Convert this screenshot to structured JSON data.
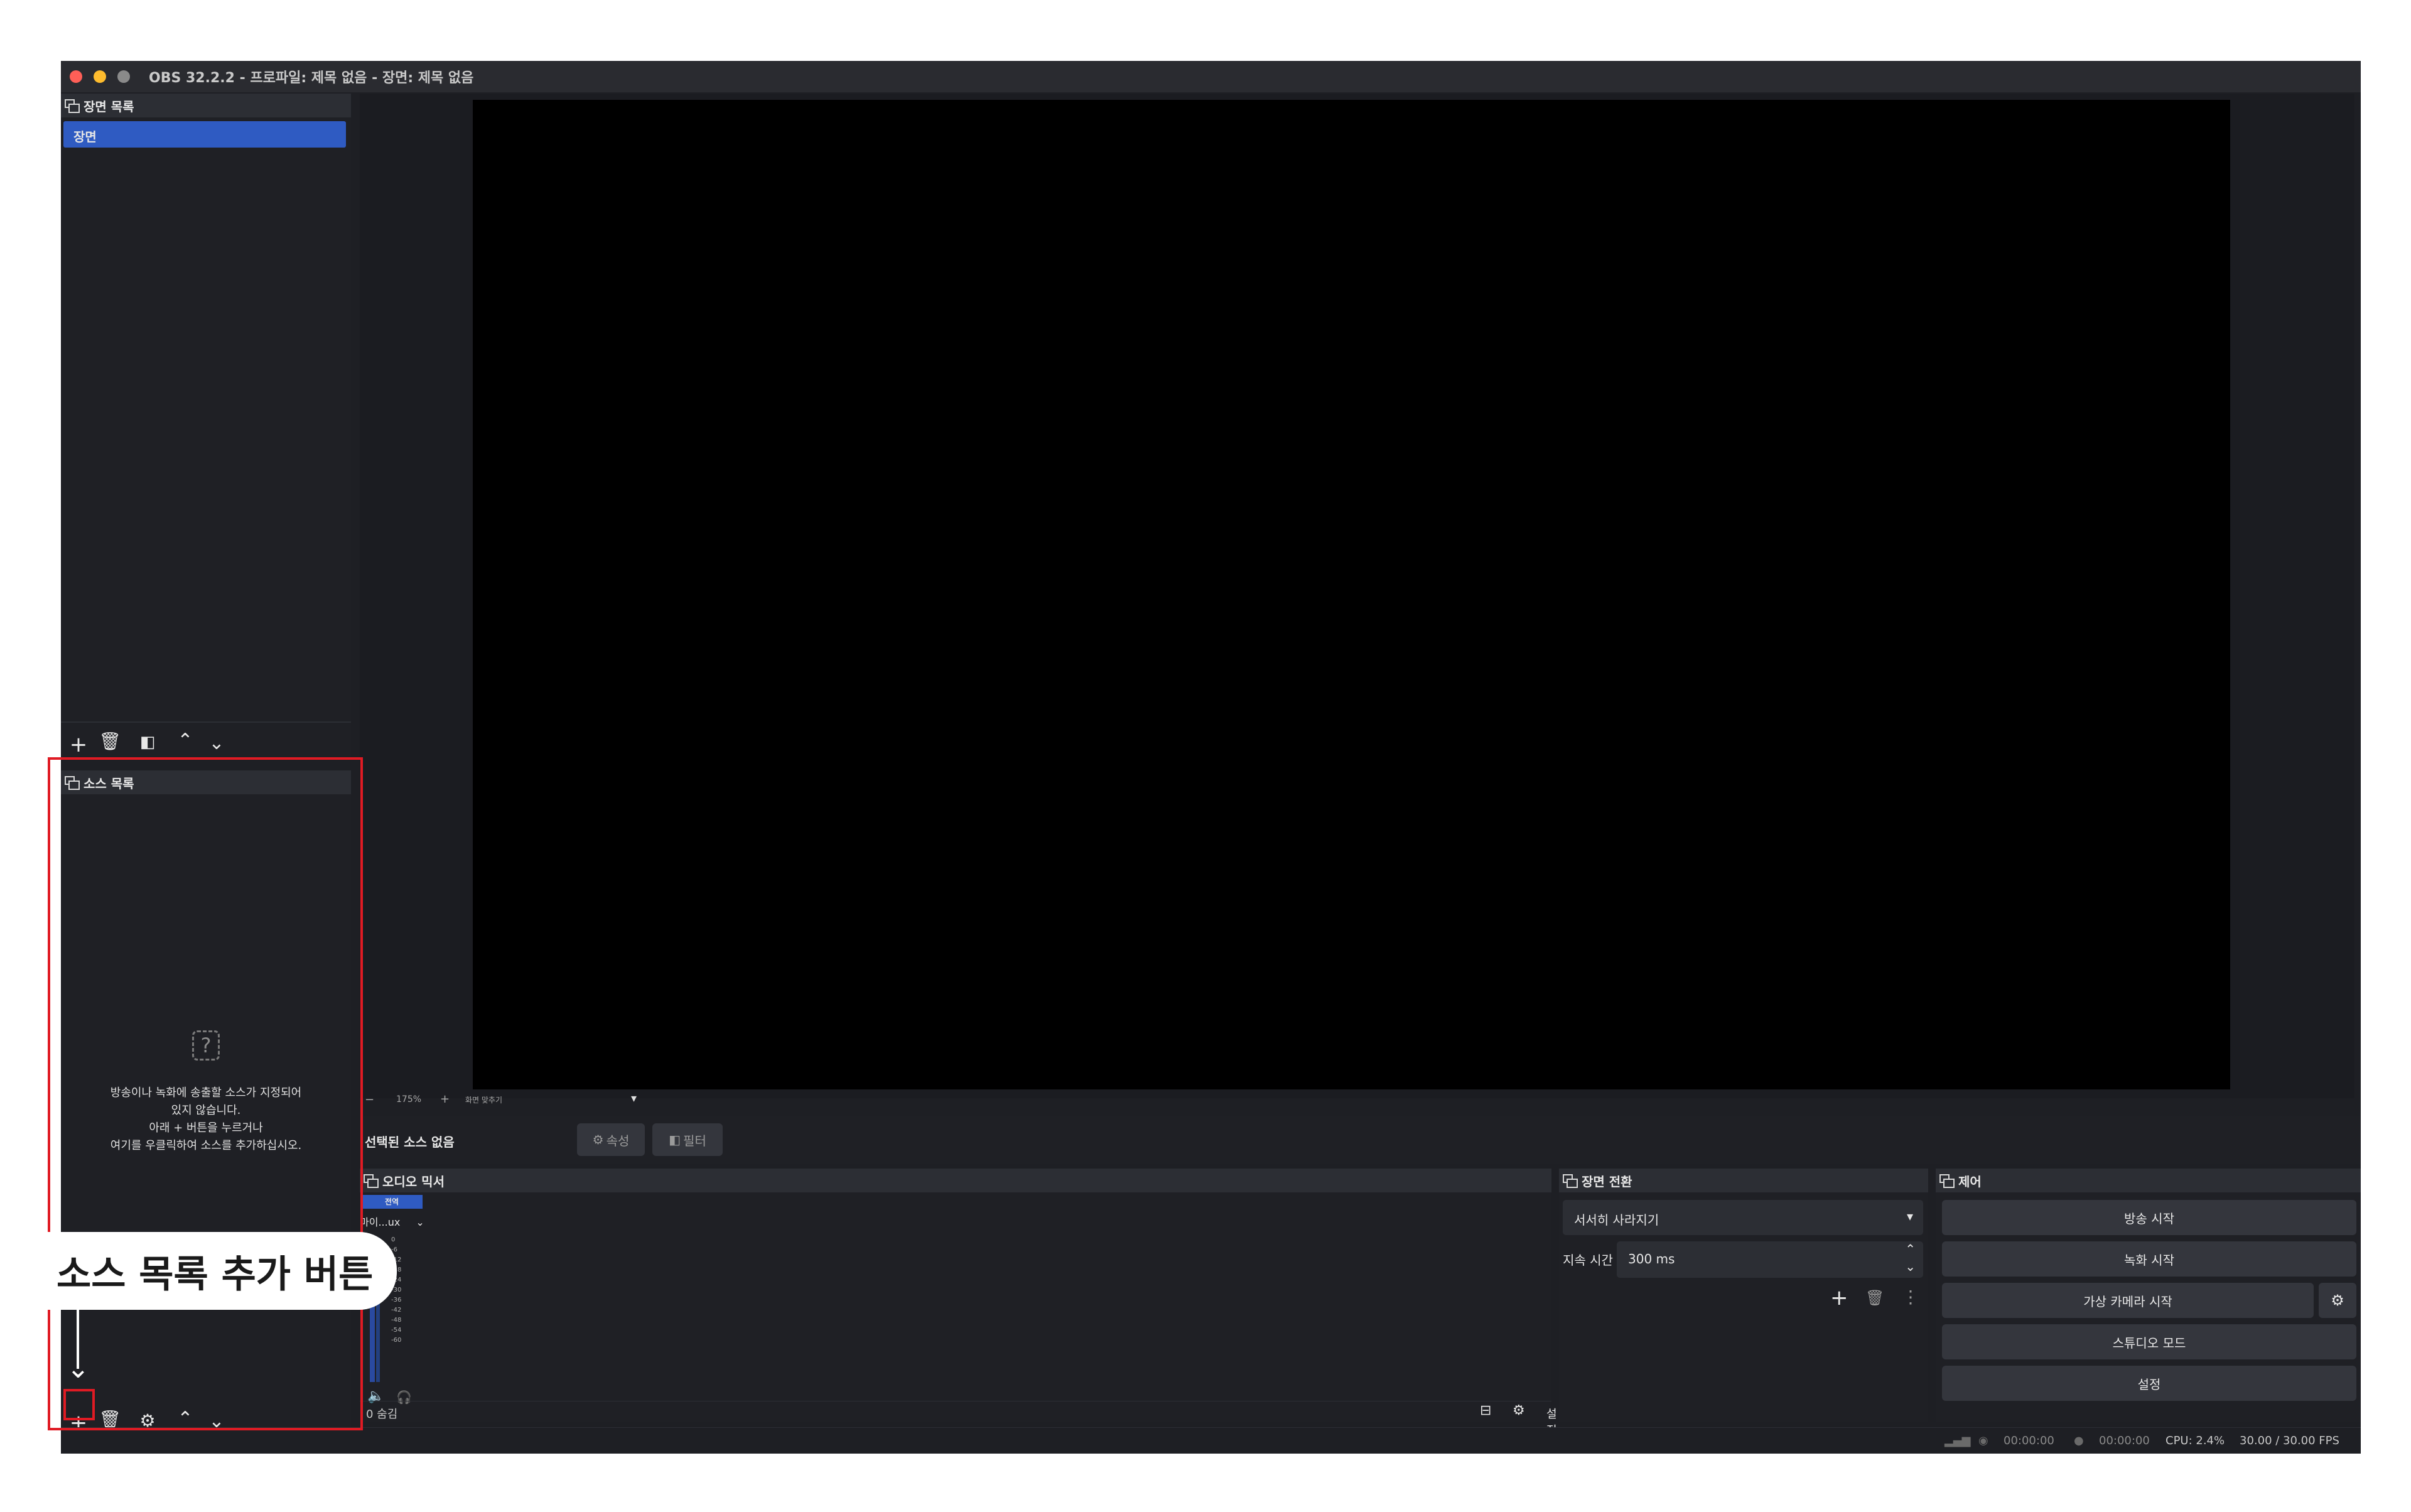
{
  "window": {
    "title": "OBS 32.2.2 - 프로파일: 제목 없음 - 장면: 제목 없음"
  },
  "scenes": {
    "header": "장면 목록",
    "items": [
      "장면"
    ]
  },
  "sources": {
    "header": "소스 목록",
    "empty_lines": [
      "방송이나 녹화에 송출할 소스가 지정되어",
      "있지 않습니다.",
      "아래 + 버튼을 누르거나",
      "여기를 우클릭하여 소스를 추가하십시오."
    ]
  },
  "preview_toolbar": {
    "zoom_out": "−",
    "zoom": "175%",
    "zoom_in": "+",
    "fit": "화면 맞추기"
  },
  "context_bar": {
    "no_source": "선택된 소스 없음",
    "properties": "속성",
    "filters": "필터"
  },
  "audio": {
    "header": "오디오 믹서",
    "tab": "전역",
    "device": "마이...ux",
    "scale": [
      "0",
      "-6",
      "-12",
      "-18",
      "-24",
      "-30",
      "-36",
      "-42",
      "-48",
      "-54",
      "-60"
    ],
    "hidden": "0 숨김",
    "settings": "설정"
  },
  "transition": {
    "header": "장면 전환",
    "selected": "서서히 사라지기",
    "duration_label": "지속 시간",
    "duration_value": "300 ms"
  },
  "controls": {
    "header": "제어",
    "start_stream": "방송 시작",
    "start_record": "녹화 시작",
    "start_vcam": "가상 카메라 시작",
    "studio_mode": "스튜디오 모드",
    "settings": "설정"
  },
  "statusbar": {
    "stream_time": "00:00:00",
    "record_time": "00:00:00",
    "cpu": "CPU: 2.4%",
    "fps": "30.00 / 30.00 FPS"
  },
  "annotation": {
    "callout": "소스 목록 추가 버튼",
    "highlight_color": "#e01b24"
  }
}
